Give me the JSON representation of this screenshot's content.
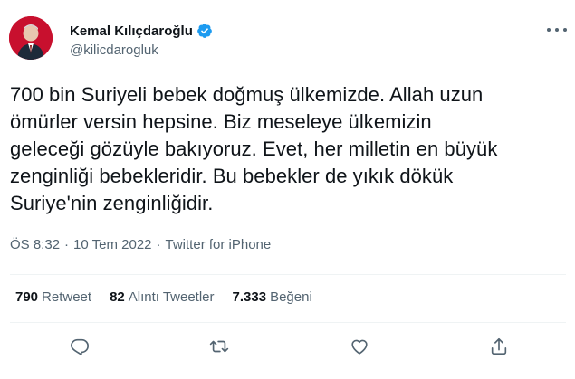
{
  "author": {
    "display_name": "Kemal Kılıçdaroğlu",
    "handle": "@kilicdarogluk",
    "verified": true
  },
  "tweet": {
    "lines": [
      "700 bin Suriyeli bebek doğmuş ülkemizde. Allah uzun",
      "ömürler versin hepsine. Biz meseleye ülkemizin",
      "geleceği gözüyle bakıyoruz. Evet, her milletin en büyük",
      "zenginliği bebekleridir. Bu bebekler de yıkık dökük",
      "Suriye'nin zenginliğidir."
    ]
  },
  "meta": {
    "time": "ÖS 8:32",
    "separator": "·",
    "date": "10 Tem 2022",
    "source": "Twitter for iPhone"
  },
  "stats": {
    "retweets": {
      "count": "790",
      "label": "Retweet"
    },
    "quotes": {
      "count": "82",
      "label": "Alıntı Tweetler"
    },
    "likes": {
      "count": "7.333",
      "label": "Beğeni"
    }
  },
  "icons": {
    "verified": "verified-badge-icon",
    "more": "more-dots-icon",
    "reply": "reply-icon",
    "retweet": "retweet-icon",
    "like": "like-icon",
    "share": "share-icon"
  },
  "colors": {
    "text_primary": "#0f1419",
    "text_secondary": "#536471",
    "verified_blue": "#1d9bf0",
    "divider": "#eff3f4",
    "avatar_bg": "#c8102e"
  }
}
